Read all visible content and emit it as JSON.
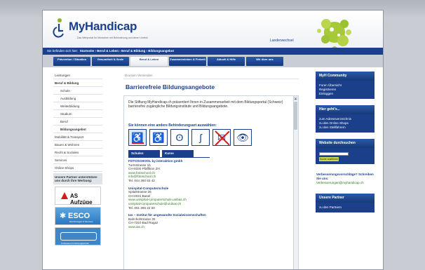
{
  "header": {
    "logo_text": "MyHandicap",
    "tagline": "Das Webportal für Menschen mit Behinderung und deren Umfeld",
    "language": "Landerwechsel"
  },
  "breadcrumb": {
    "prefix": "Sie befinden sich hier:",
    "path": "Startseite › Beruf & Leben › Beruf & Bildung › Bildungsangebot"
  },
  "nav": {
    "tabs": [
      {
        "label": "Prävention / Situation"
      },
      {
        "label": "Gesundheit & Seele"
      },
      {
        "label": "Beruf & Leben"
      },
      {
        "label": "Zusammenleben & Freizeit"
      },
      {
        "label": "Aktuell & Hilfe"
      },
      {
        "label": "Wir über uns"
      }
    ],
    "active_index": 2
  },
  "sidebar": {
    "items": [
      {
        "label": "Leistungen"
      },
      {
        "label": "Beruf & Bildung"
      },
      {
        "label": "Schule"
      },
      {
        "label": "Ausbildung"
      },
      {
        "label": "Weiterbildung"
      },
      {
        "label": "Studium"
      },
      {
        "label": "Beruf"
      },
      {
        "label": "Bildungsangebot"
      },
      {
        "label": "Mobilität & Transport"
      },
      {
        "label": "Bauen & Wohnen"
      },
      {
        "label": "Recht & Soziales"
      },
      {
        "label": "Services"
      },
      {
        "label": "Online-Shops"
      }
    ],
    "partner_title": "Unsere Partner unterstützen uns durch ihre Werbung:",
    "partners": {
      "as": "AS Aufzüge",
      "esco": "ESCO",
      "esco_sub": "Einrichtungen & Services",
      "third": "Umbauten & Fahrzeugtechnik"
    }
  },
  "main": {
    "tools": "Drucken     Versenden",
    "title": "Barrierefreie Bildungsangebote",
    "intro": "Die Stiftung MyHandicap.ch präsentiert Ihnen in Zusammenarbeit mit dem Bildungsportal (Schweiz) barrierefrei zugängliche Bildungsinstitute und Bildungsangebote.",
    "choose_label": "Sie können eine andere Behinderungsart auswählen:",
    "tabs": [
      "Schulen",
      "Kurse"
    ],
    "schools": [
      {
        "name": "FOTOSCHOOL by interaktion gmbh",
        "street": "Turmstrasse 1b",
        "city": "CH-8330 Pfäffikon ZH",
        "web": "www.fotoschool.ch",
        "mail": "info@fotoschool.ch",
        "tel": "Tel. 044 260 83 42"
      },
      {
        "name": "Unispital-Computerschule",
        "street": "Spitalstrasse 26",
        "city": "CH-4031 Basel",
        "web": "www.unispital-computerschule.unibas.ch",
        "mail": "unispital-computerschule@unibas.ch",
        "tel": "Tel. 061 265 22 00"
      },
      {
        "name": "Ias – Institut für angewandte Sozialwissenschaften",
        "street": "Bahnhofstrasse 30",
        "city": "CH-7310 Bad Ragaz",
        "web": "www.ias.ch",
        "mail": "",
        "tel": ""
      }
    ]
  },
  "right": {
    "community_title": "MyH Community",
    "community_items": [
      "Foren Übersicht",
      "Registrieren",
      "Einloggen"
    ],
    "shop_title": "Hier geht's...",
    "shop_items": [
      "zum Adressverzeichnis",
      "zu den Online Shops",
      "zu den Stellfahrern"
    ],
    "search_title": "Website durchsuchen",
    "search_button": "Suche ausführen",
    "suggest_bold": "Verbesserungsvorschläge? Schreiben Sie uns:",
    "suggest_link": "Verbesserungen@myhandicap.ch",
    "partner_title": "Unsere Partner",
    "partner_item": "zu den Partnern"
  }
}
